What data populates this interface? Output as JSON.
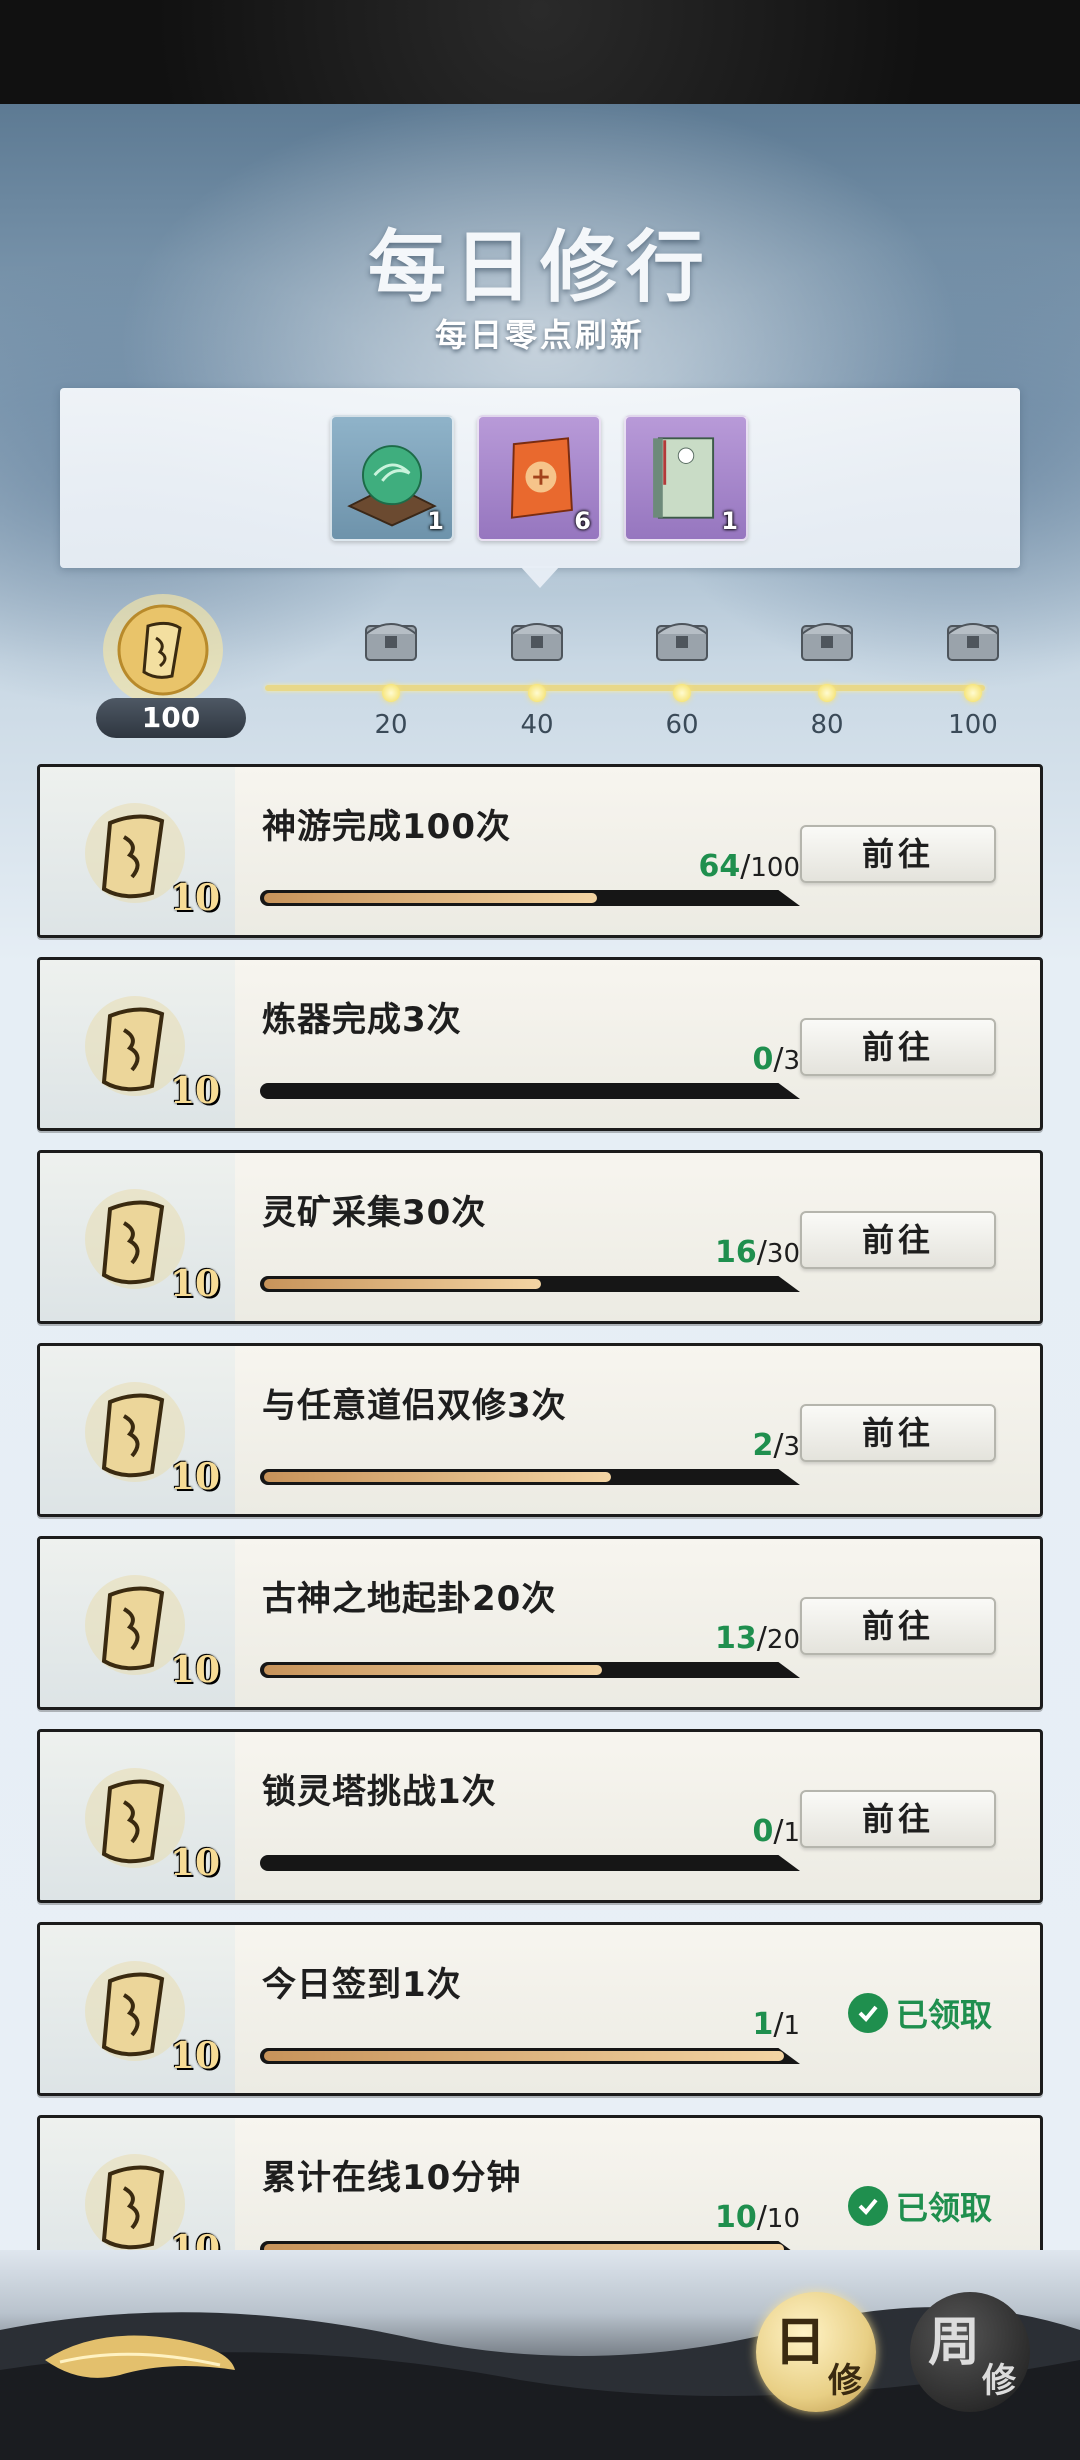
{
  "header": {
    "title": "每日修行",
    "subtitle": "每日零点刷新"
  },
  "rewards": [
    {
      "icon": "jade-orb-icon",
      "count": "1",
      "rarity": "blue"
    },
    {
      "icon": "talisman-pouch-icon",
      "count": "6",
      "rarity": "purple"
    },
    {
      "icon": "scroll-book-icon",
      "count": "1",
      "rarity": "purple"
    }
  ],
  "activity": {
    "current_value": "100",
    "milestones": [
      "20",
      "40",
      "60",
      "80",
      "100"
    ]
  },
  "tasks": [
    {
      "name": "神游完成100次",
      "points": "10",
      "current": "64",
      "total": "100",
      "progress": 0.64,
      "status": "go",
      "button": "前往"
    },
    {
      "name": "炼器完成3次",
      "points": "10",
      "current": "0",
      "total": "3",
      "progress": 0,
      "status": "go",
      "button": "前往"
    },
    {
      "name": "灵矿采集30次",
      "points": "10",
      "current": "16",
      "total": "30",
      "progress": 0.533,
      "status": "go",
      "button": "前往"
    },
    {
      "name": "与任意道侣双修3次",
      "points": "10",
      "current": "2",
      "total": "3",
      "progress": 0.667,
      "status": "go",
      "button": "前往"
    },
    {
      "name": "古神之地起卦20次",
      "points": "10",
      "current": "13",
      "total": "20",
      "progress": 0.65,
      "status": "go",
      "button": "前往"
    },
    {
      "name": "锁灵塔挑战1次",
      "points": "10",
      "current": "0",
      "total": "1",
      "progress": 0,
      "status": "go",
      "button": "前往"
    },
    {
      "name": "今日签到1次",
      "points": "10",
      "current": "1",
      "total": "1",
      "progress": 1,
      "status": "claimed",
      "button": "已领取"
    },
    {
      "name": "累计在线10分钟",
      "points": "10",
      "current": "10",
      "total": "10",
      "progress": 1,
      "status": "claimed",
      "button": "已领取"
    }
  ],
  "tabs": {
    "day": {
      "big": "日",
      "small": "修"
    },
    "week": {
      "big": "周",
      "small": "修"
    }
  },
  "colors": {
    "progress_text_green": "#1f8f4e",
    "bar_fill": "#e5b57a",
    "dark_border": "#1c1c1c"
  }
}
